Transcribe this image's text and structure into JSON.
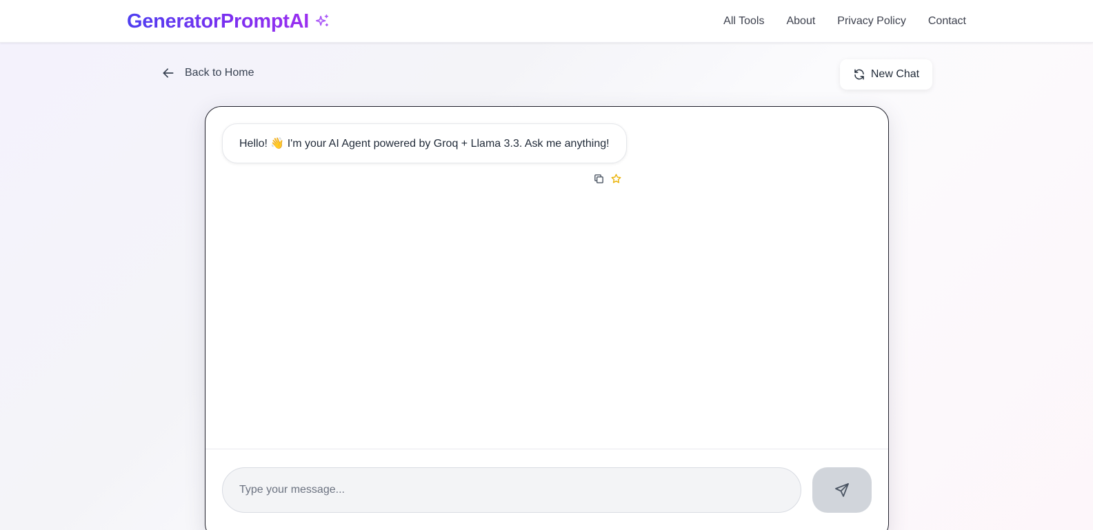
{
  "header": {
    "logo_text": "GeneratorPromptAI",
    "logo_icon": "sparkles-icon",
    "nav": [
      {
        "label": "All Tools"
      },
      {
        "label": "About"
      },
      {
        "label": "Privacy Policy"
      },
      {
        "label": "Contact"
      }
    ]
  },
  "back_link": {
    "label": "Back to Home",
    "icon": "arrow-left-icon"
  },
  "new_chat": {
    "label": "New Chat",
    "icon": "refresh-icon"
  },
  "chat": {
    "messages": [
      {
        "role": "assistant",
        "text": "Hello! 👋 I'm your AI Agent powered by Groq + Llama 3.3. Ask me anything!",
        "actions": [
          "copy-icon",
          "star-icon"
        ]
      }
    ],
    "input": {
      "placeholder": "Type your message...",
      "value": ""
    },
    "send_icon": "send-icon"
  },
  "colors": {
    "brand_start": "#4f3ff0",
    "brand_end": "#9b2ff0",
    "star": "#eab308",
    "send_button_bg": "#d1d5db"
  }
}
